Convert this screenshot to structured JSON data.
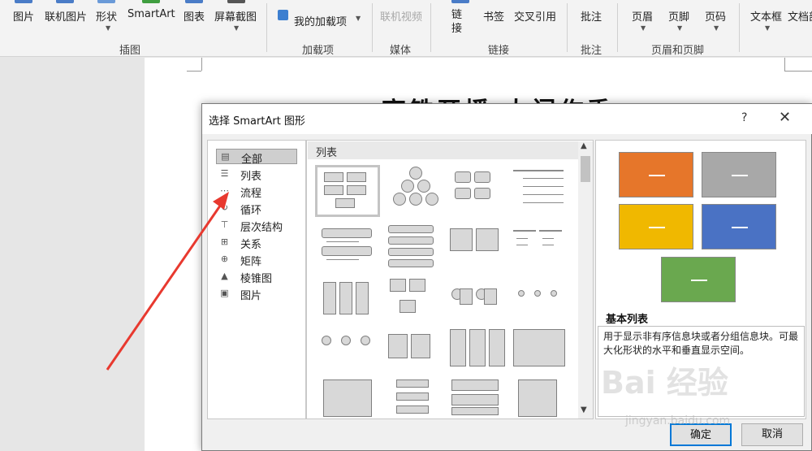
{
  "ribbon": {
    "buttons": {
      "pictures": "图片",
      "online_pictures": "联机图片",
      "shapes": "形状",
      "smartart": "SmartArt",
      "chart": "图表",
      "screenshot": "屏幕截图",
      "my_addins": "我的加载项",
      "online_video": "联机视频",
      "link": "链接",
      "bookmark": "书签",
      "cross_ref": "交叉引用",
      "comment": "批注",
      "header": "页眉",
      "footer": "页脚",
      "page_number": "页码",
      "textbox": "文本框",
      "text_more": "文档部"
    },
    "groups": {
      "illustrations": "插图",
      "addins": "加载项",
      "media": "媒体",
      "links": "链接",
      "comments": "批注",
      "header_footer": "页眉和页脚"
    }
  },
  "document": {
    "heading": "高铁开播 大门作秀"
  },
  "dialog": {
    "title": "选择 SmartArt 图形",
    "help": "?",
    "close": "✕",
    "categories": [
      {
        "label": "全部",
        "icon": "all-icon"
      },
      {
        "label": "列表",
        "icon": "list-icon"
      },
      {
        "label": "流程",
        "icon": "process-icon"
      },
      {
        "label": "循环",
        "icon": "cycle-icon"
      },
      {
        "label": "层次结构",
        "icon": "hierarchy-icon"
      },
      {
        "label": "关系",
        "icon": "relationship-icon"
      },
      {
        "label": "矩阵",
        "icon": "matrix-icon"
      },
      {
        "label": "棱锥图",
        "icon": "pyramid-icon"
      },
      {
        "label": "图片",
        "icon": "picture-icon"
      }
    ],
    "selected_category": "全部",
    "layout_header": "列表",
    "preview": {
      "name": "基本列表",
      "description": "用于显示非有序信息块或者分组信息块。可最大化形状的水平和垂直显示空间。",
      "colors": [
        "#e6762a",
        "#a8a8a8",
        "#f0b800",
        "#4a72c4",
        "#6aa84f"
      ]
    },
    "ok": "确定",
    "cancel": "取消"
  },
  "watermark": {
    "text": "Bai 经验",
    "sub": "jingyan.baidu.com"
  }
}
